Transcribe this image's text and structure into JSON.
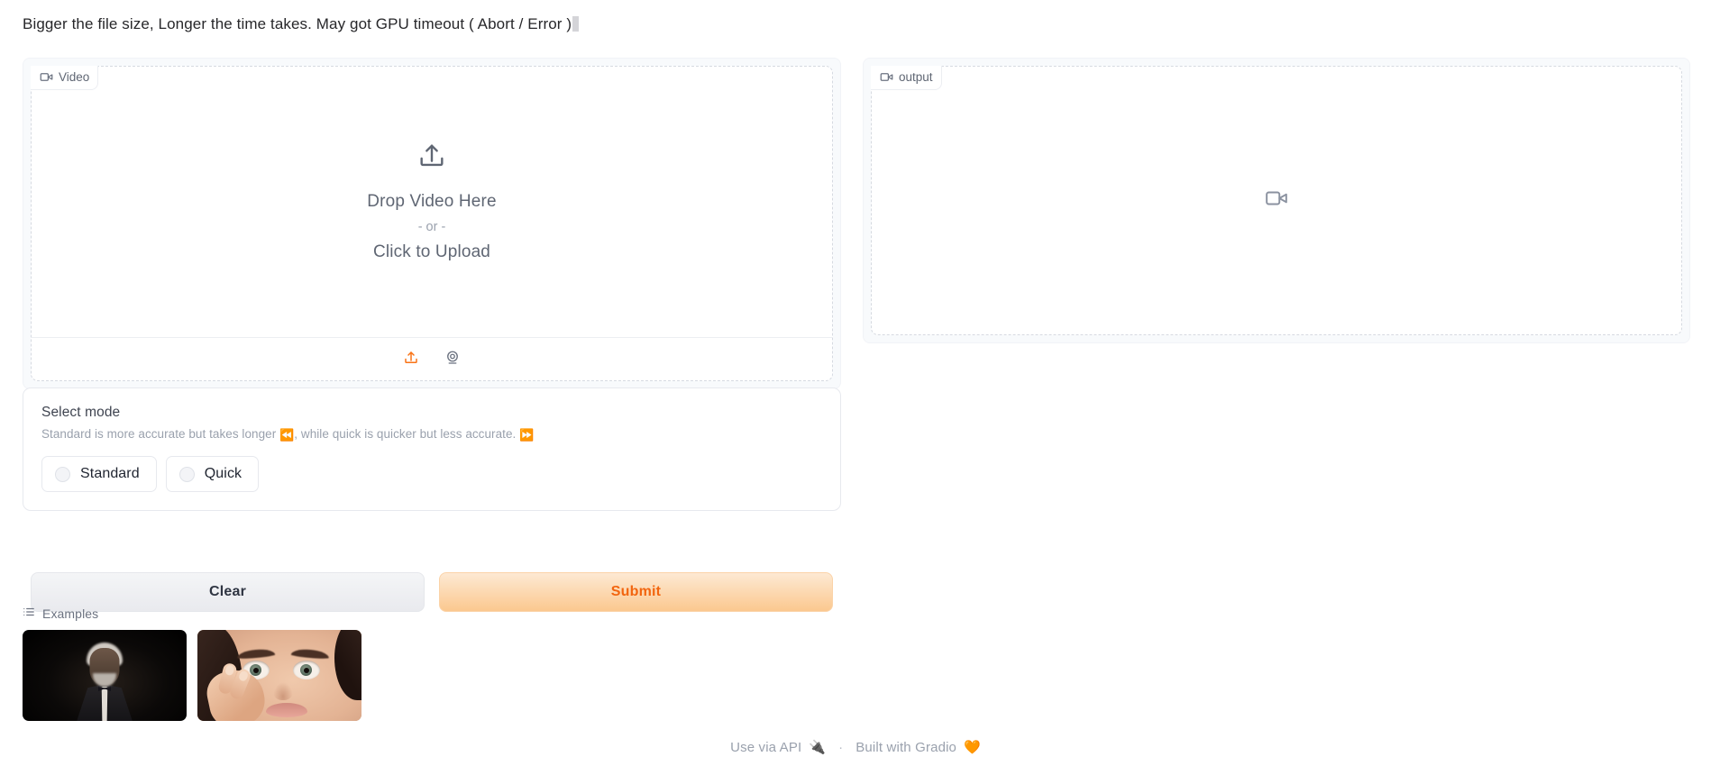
{
  "heading": {
    "text": "Bigger the file size, Longer the time takes. May got GPU timeout ( Abort / Error )"
  },
  "input_panel": {
    "label": "Video",
    "label_icon": "video-camera-icon",
    "drop_title": "Drop Video Here",
    "drop_or": "- or -",
    "drop_click": "Click to Upload",
    "drop_icon": "upload-icon",
    "sources": [
      {
        "name": "upload-source-button",
        "icon": "upload-icon",
        "color": "#f97316"
      },
      {
        "name": "webcam-source-button",
        "icon": "webcam-icon",
        "color": "#6b7280"
      }
    ]
  },
  "output_panel": {
    "label": "output",
    "label_icon": "video-camera-icon",
    "empty_icon": "video-camera-icon"
  },
  "mode": {
    "title": "Select mode",
    "info_prefix": "Standard is more accurate but takes longer ",
    "info_emoji_1": "⏪",
    "info_middle": ", while quick is quicker but less accurate. ",
    "info_emoji_2": "⏩",
    "options": [
      {
        "label": "Standard",
        "selected": false
      },
      {
        "label": "Quick",
        "selected": false
      }
    ]
  },
  "actions": {
    "clear_label": "Clear",
    "submit_label": "Submit",
    "submit_color": "#f2650f"
  },
  "examples": {
    "header": "Examples",
    "header_icon": "list-icon",
    "items": [
      {
        "name": "example-thumbnail-1",
        "alt": "dark portrait of an older man in a suit"
      },
      {
        "name": "example-thumbnail-2",
        "alt": "close-up of a woman with wide eyes and hand on cheek"
      }
    ]
  },
  "footer": {
    "api_label": "Use via API",
    "api_emoji": "🔌",
    "separator": "·",
    "gradio_label": "Built with Gradio",
    "gradio_emoji": "🧡"
  }
}
